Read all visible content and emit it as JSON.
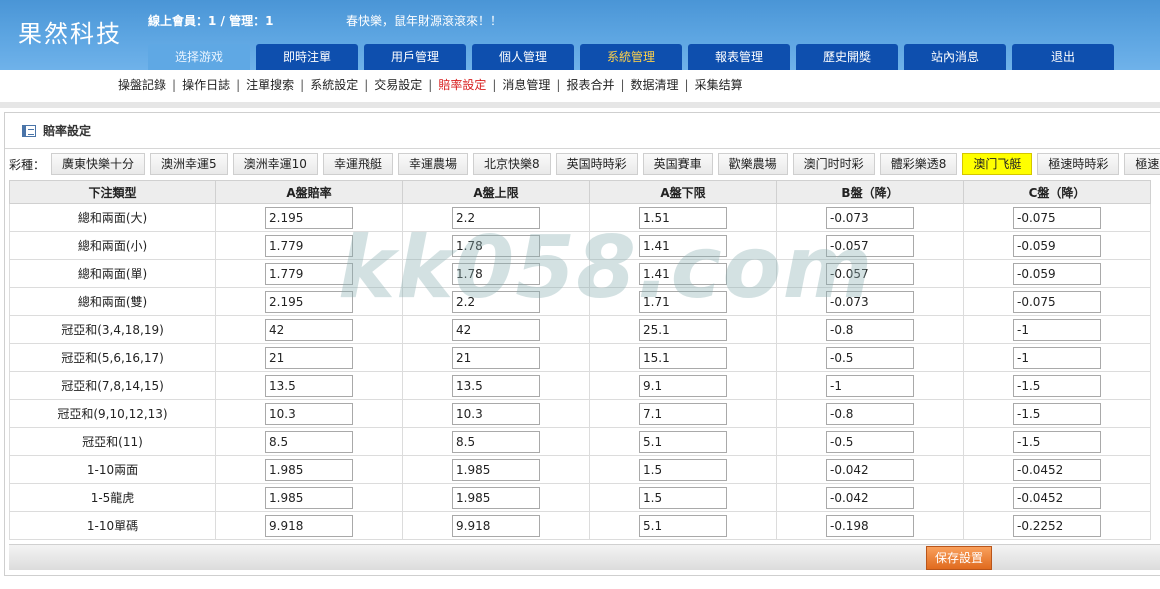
{
  "app": {
    "logo": "果然科技",
    "online_text": "線上會員：1 / 管理：1",
    "marquee": "春快樂，鼠年財源滾滾來！！"
  },
  "nav": [
    {
      "label": "选择游戏",
      "active": true
    },
    {
      "label": "即時注單"
    },
    {
      "label": "用戶管理"
    },
    {
      "label": "個人管理"
    },
    {
      "label": "系統管理",
      "highlight": true
    },
    {
      "label": "報表管理"
    },
    {
      "label": "歷史開獎"
    },
    {
      "label": "站內消息"
    },
    {
      "label": "退出"
    }
  ],
  "subnav": [
    {
      "label": "操盤記錄"
    },
    {
      "label": "操作日誌"
    },
    {
      "label": "注單搜索"
    },
    {
      "label": "系統設定"
    },
    {
      "label": "交易設定"
    },
    {
      "label": "賠率設定",
      "current": true
    },
    {
      "label": "消息管理"
    },
    {
      "label": "报表合并"
    },
    {
      "label": "数据清理"
    },
    {
      "label": "采集结算"
    }
  ],
  "panel": {
    "title": "賠率設定",
    "games_label": "彩種：",
    "games": [
      {
        "label": "廣東快樂十分"
      },
      {
        "label": "澳洲幸運5"
      },
      {
        "label": "澳洲幸運10"
      },
      {
        "label": "幸運飛艇"
      },
      {
        "label": "幸運農場"
      },
      {
        "label": "北京快樂8"
      },
      {
        "label": "英国時時彩"
      },
      {
        "label": "英国賽車"
      },
      {
        "label": "歡樂農場"
      },
      {
        "label": "澳门时时彩"
      },
      {
        "label": "體彩樂透8"
      },
      {
        "label": "澳门飞艇",
        "active": true
      },
      {
        "label": "極速時時彩"
      },
      {
        "label": "極速賽車"
      }
    ],
    "columns": [
      "下注類型",
      "A盤賠率",
      "A盤上限",
      "A盤下限",
      "B盤（降）",
      "C盤（降）"
    ],
    "rows": [
      {
        "type": "總和兩面(大)",
        "values": [
          "2.195",
          "2.2",
          "1.51",
          "-0.073",
          "-0.075"
        ]
      },
      {
        "type": "總和兩面(小)",
        "values": [
          "1.779",
          "1.78",
          "1.41",
          "-0.057",
          "-0.059"
        ]
      },
      {
        "type": "總和兩面(單)",
        "values": [
          "1.779",
          "1.78",
          "1.41",
          "-0.057",
          "-0.059"
        ]
      },
      {
        "type": "總和兩面(雙)",
        "values": [
          "2.195",
          "2.2",
          "1.71",
          "-0.073",
          "-0.075"
        ]
      },
      {
        "type": "冠亞和(3,4,18,19)",
        "values": [
          "42",
          "42",
          "25.1",
          "-0.8",
          "-1"
        ]
      },
      {
        "type": "冠亞和(5,6,16,17)",
        "values": [
          "21",
          "21",
          "15.1",
          "-0.5",
          "-1"
        ]
      },
      {
        "type": "冠亞和(7,8,14,15)",
        "values": [
          "13.5",
          "13.5",
          "9.1",
          "-1",
          "-1.5"
        ]
      },
      {
        "type": "冠亞和(9,10,12,13)",
        "values": [
          "10.3",
          "10.3",
          "7.1",
          "-0.8",
          "-1.5"
        ]
      },
      {
        "type": "冠亞和(11)",
        "values": [
          "8.5",
          "8.5",
          "5.1",
          "-0.5",
          "-1.5"
        ]
      },
      {
        "type": "1-10兩面",
        "values": [
          "1.985",
          "1.985",
          "1.5",
          "-0.042",
          "-0.0452"
        ]
      },
      {
        "type": "1-5龍虎",
        "values": [
          "1.985",
          "1.985",
          "1.5",
          "-0.042",
          "-0.0452"
        ]
      },
      {
        "type": "1-10單碼",
        "values": [
          "9.918",
          "9.918",
          "5.1",
          "-0.198",
          "-0.2252"
        ]
      }
    ],
    "save_label": "保存設置"
  },
  "watermark": "kk058.com"
}
